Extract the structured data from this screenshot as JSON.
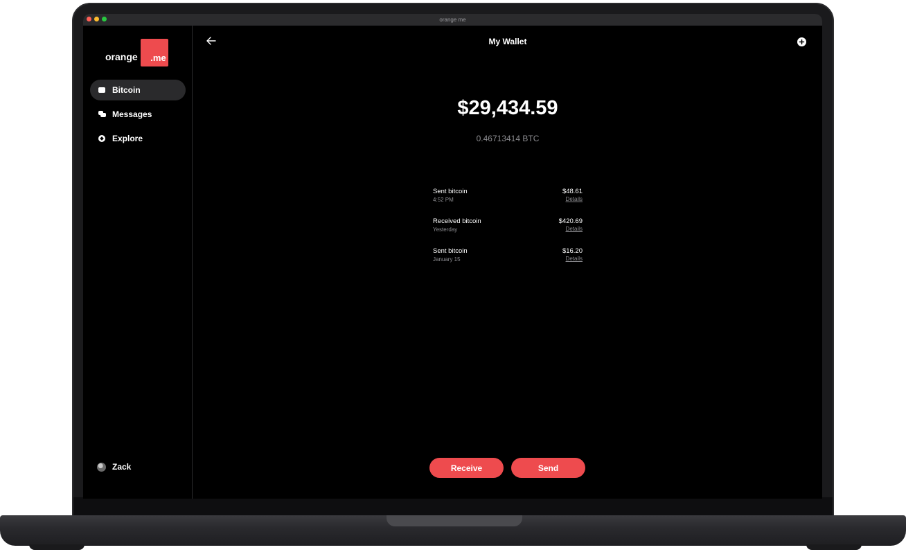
{
  "window": {
    "title": "orange me"
  },
  "logo": {
    "word": "orange",
    "badge": ".me",
    "brand_color": "#ee4b4e"
  },
  "sidebar": {
    "items": [
      {
        "label": "Bitcoin",
        "icon": "wallet-icon",
        "active": true
      },
      {
        "label": "Messages",
        "icon": "chat-icon",
        "active": false
      },
      {
        "label": "Explore",
        "icon": "compass-icon",
        "active": false
      }
    ],
    "user": {
      "name": "Zack",
      "icon": "avatar"
    }
  },
  "header": {
    "back_icon": "arrow-left-icon",
    "title": "My Wallet",
    "add_icon": "plus-circle-icon"
  },
  "balance": {
    "usd": "$29,434.59",
    "btc": "0.46713414 BTC"
  },
  "transactions": [
    {
      "title": "Sent bitcoin",
      "date": "4:52 PM",
      "amount": "$48.61",
      "link": "Details"
    },
    {
      "title": "Received bitcoin",
      "date": "Yesterday",
      "amount": "$420.69",
      "link": "Details"
    },
    {
      "title": "Sent bitcoin",
      "date": "January 15",
      "amount": "$16.20",
      "link": "Details"
    }
  ],
  "actions": {
    "receive_label": "Receive",
    "send_label": "Send"
  }
}
